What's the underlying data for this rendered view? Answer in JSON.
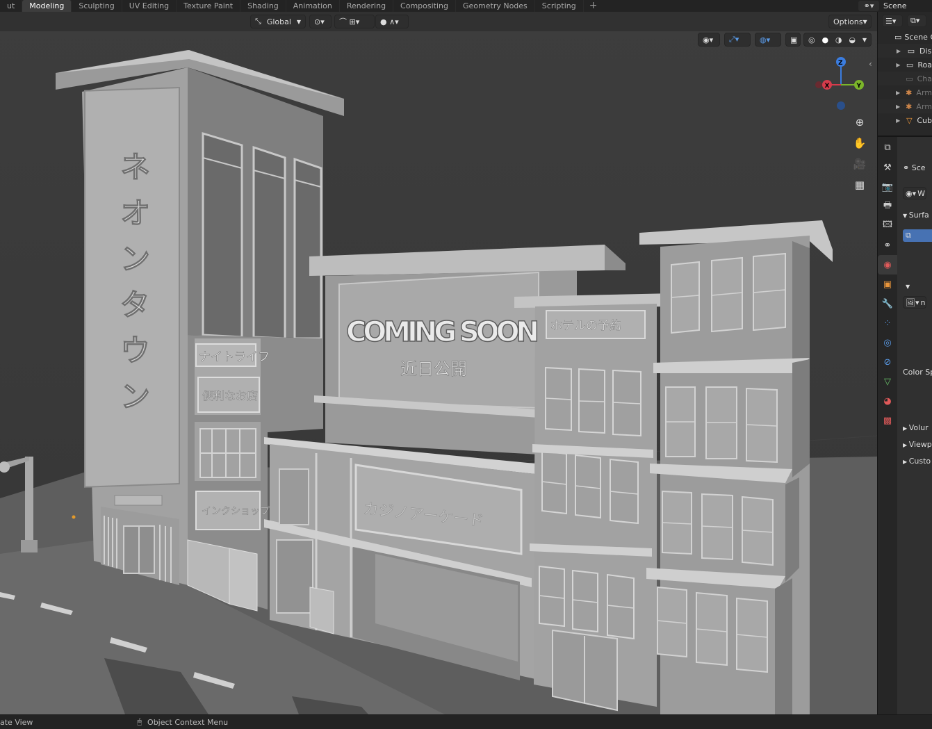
{
  "workspace_tabs": [
    "ut",
    "Modeling",
    "Sculpting",
    "UV Editing",
    "Texture Paint",
    "Shading",
    "Animation",
    "Rendering",
    "Compositing",
    "Geometry Nodes",
    "Scripting"
  ],
  "active_tab_index": 1,
  "add_tab_label": "+",
  "scene": {
    "name": "Scene"
  },
  "viewport_header": {
    "transform_orientation": "Global",
    "options_label": "Options"
  },
  "gizmo": {
    "z_label": "Z",
    "x_label": "X",
    "y_label": "Y"
  },
  "scene_signs": {
    "tower": "ネオンタウン",
    "night_life": "ナイトライフ",
    "convenience": "便利なお店",
    "ink_shop": "インクショップ",
    "coming_soon": "COMING SOON",
    "coming_soon_jp": "近日公開",
    "hotel": "ホテルの予約",
    "casino": "カジノアーケード"
  },
  "outliner": {
    "collection_label": "Scene C",
    "rows": [
      {
        "label": "Dis",
        "icon": "collection-icon"
      },
      {
        "label": "Roa",
        "icon": "collection-icon"
      },
      {
        "label": "Cha",
        "icon": "collection-icon"
      },
      {
        "label": "Arm",
        "icon": "armature-icon"
      },
      {
        "label": "Arm",
        "icon": "armature-icon"
      },
      {
        "label": "Cub",
        "icon": "mesh-icon"
      }
    ]
  },
  "properties": {
    "scene_label": "Sce",
    "world_label": "W",
    "surface_label": "Surfa",
    "color_space_label": "Color Sp",
    "volume_label": "Volur",
    "viewport_label": "Viewp",
    "custom_label": "Custo",
    "image_field_label": "n"
  },
  "status_bar": {
    "left_label": "ate View",
    "context_menu_label": "Object Context Menu"
  },
  "colors": {
    "active_tab": "#3d3d3d",
    "accent_blue": "#4772b3",
    "axis_x": "#d63b4b",
    "axis_y": "#7bb52a",
    "axis_z": "#3b7de0"
  }
}
